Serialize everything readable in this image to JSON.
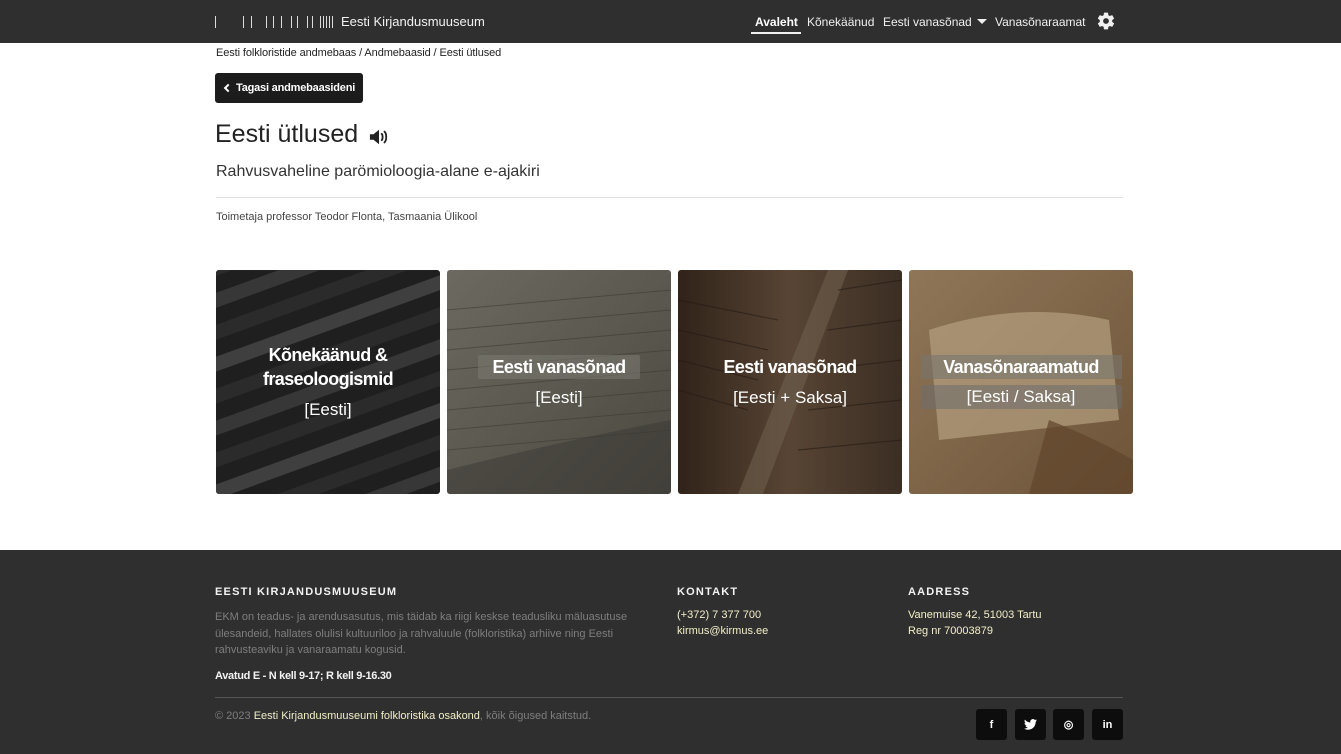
{
  "navbar": {
    "brand": "Eesti Kirjandusmuuseum",
    "links": [
      {
        "label": "Avaleht"
      },
      {
        "label": "Kõnekäänud"
      },
      {
        "label": "Eesti vanasõnad"
      },
      {
        "label": "Vanasõnaraamat"
      }
    ],
    "settings_icon": "gear-icon"
  },
  "breadcrumb": "Eesti folkloristide andmebaas / Andmebaasid / Eesti ütlused",
  "back_button": "Tagasi andmebaasideni",
  "page": {
    "title": "Eesti ütlused",
    "subtitle": "Rahvusvaheline parömioloogia-alane e-ajakiri",
    "editor": "Toimetaja professor Teodor Flonta, Tasmaania Ülikool"
  },
  "cards": [
    {
      "title_line1": "Kõnekäänud &",
      "title_line2": "fraseoloogismid",
      "sub": "[Eesti]"
    },
    {
      "title": "Eesti vanasõnad",
      "sub": "[Eesti]"
    },
    {
      "title": "Eesti vanasõnad",
      "sub": "[Eesti + Saksa]"
    },
    {
      "title": "Vanasõnaraamatud",
      "sub": "[Eesti / Saksa]"
    }
  ],
  "footer": {
    "about_heading": "EESTI KIRJANDUSMUUSEUM",
    "about_text": "EKM on teadus- ja arendusasutus, mis täidab ka riigi keskse teadusliku mäluasutuse ülesandeid, hallates olulisi kultuuriloo ja rahvaluule (folkloristika) arhiive ning Eesti rahvusteaviku ja vanaraamatu kogusid.",
    "hours": "Avatud E - N kell 9-17; R kell 9-16.30",
    "contact_heading": "KONTAKT",
    "phone": "(+372) 7 377 700",
    "email": "kirmus@kirmus.ee",
    "address_heading": "AADRESS",
    "address_line1": "Vanemuise 42, 51003 Tartu",
    "address_line2": "Reg nr 70003879",
    "copy_prefix": "© 2023",
    "copy_link": "Eesti Kirjandusmuuseumi folkloristika osakond",
    "copy_suffix": ", kõik õigused kaitstud.",
    "social": [
      {
        "icon": "facebook-icon",
        "glyph": "f"
      },
      {
        "icon": "twitter-icon",
        "glyph": "t"
      },
      {
        "icon": "dribbble-icon",
        "glyph": "◎"
      },
      {
        "icon": "linkedin-icon",
        "glyph": "in"
      }
    ]
  }
}
